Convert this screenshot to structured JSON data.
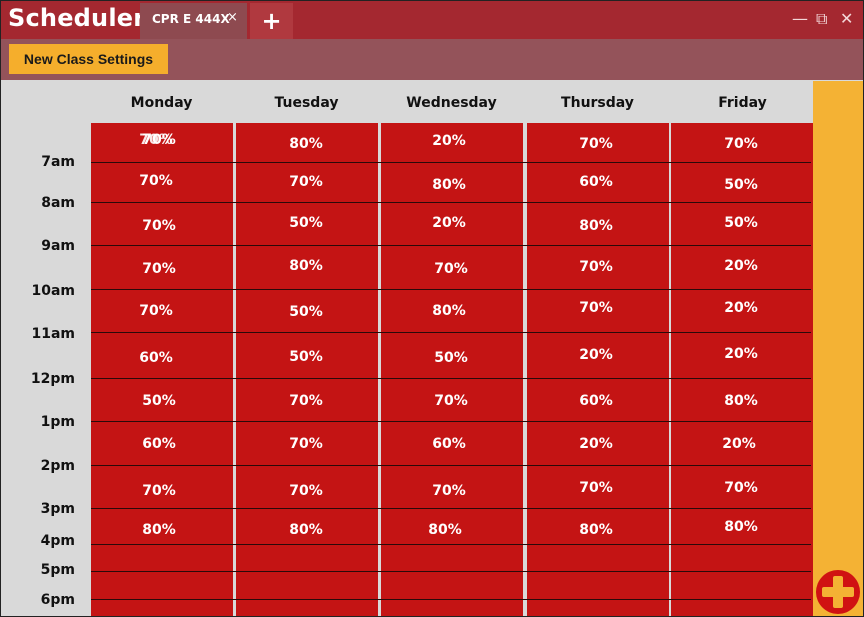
{
  "app": {
    "title": "Scheduler"
  },
  "tabs": [
    {
      "label": "CPR E 444X",
      "close": "×"
    }
  ],
  "new_tab": "+",
  "window_controls": {
    "minimize": "—",
    "restore": "⧉",
    "close": "✕"
  },
  "toolbar": {
    "new_class_label": "New Class Settings"
  },
  "days": [
    "Monday",
    "Tuesday",
    "Wednesday",
    "Thursday",
    "Friday"
  ],
  "times": [
    "7am",
    "8am",
    "9am",
    "10am",
    "11am",
    "12pm",
    "1pm",
    "2pm",
    "3pm",
    "4pm",
    "5pm",
    "6pm"
  ],
  "monday_overlap": "70%",
  "grid": [
    [
      "70%",
      "80%",
      "20%",
      "70%",
      "70%"
    ],
    [
      "70%",
      "70%",
      "80%",
      "60%",
      "50%"
    ],
    [
      "70%",
      "50%",
      "20%",
      "80%",
      "50%"
    ],
    [
      "70%",
      "80%",
      "70%",
      "70%",
      "20%"
    ],
    [
      "70%",
      "50%",
      "80%",
      "70%",
      "20%"
    ],
    [
      "60%",
      "50%",
      "50%",
      "20%",
      "20%"
    ],
    [
      "50%",
      "70%",
      "70%",
      "60%",
      "80%"
    ],
    [
      "60%",
      "70%",
      "60%",
      "20%",
      "20%"
    ],
    [
      "70%",
      "70%",
      "70%",
      "70%",
      "70%"
    ],
    [
      "80%",
      "80%",
      "80%",
      "80%",
      "80%"
    ]
  ],
  "colors": {
    "titlebar": "#a42830",
    "toolbar": "#94535a",
    "accent": "#f5ae2c",
    "cell": "#c41414"
  },
  "icons": {
    "add_class": "plus-circle-icon"
  }
}
